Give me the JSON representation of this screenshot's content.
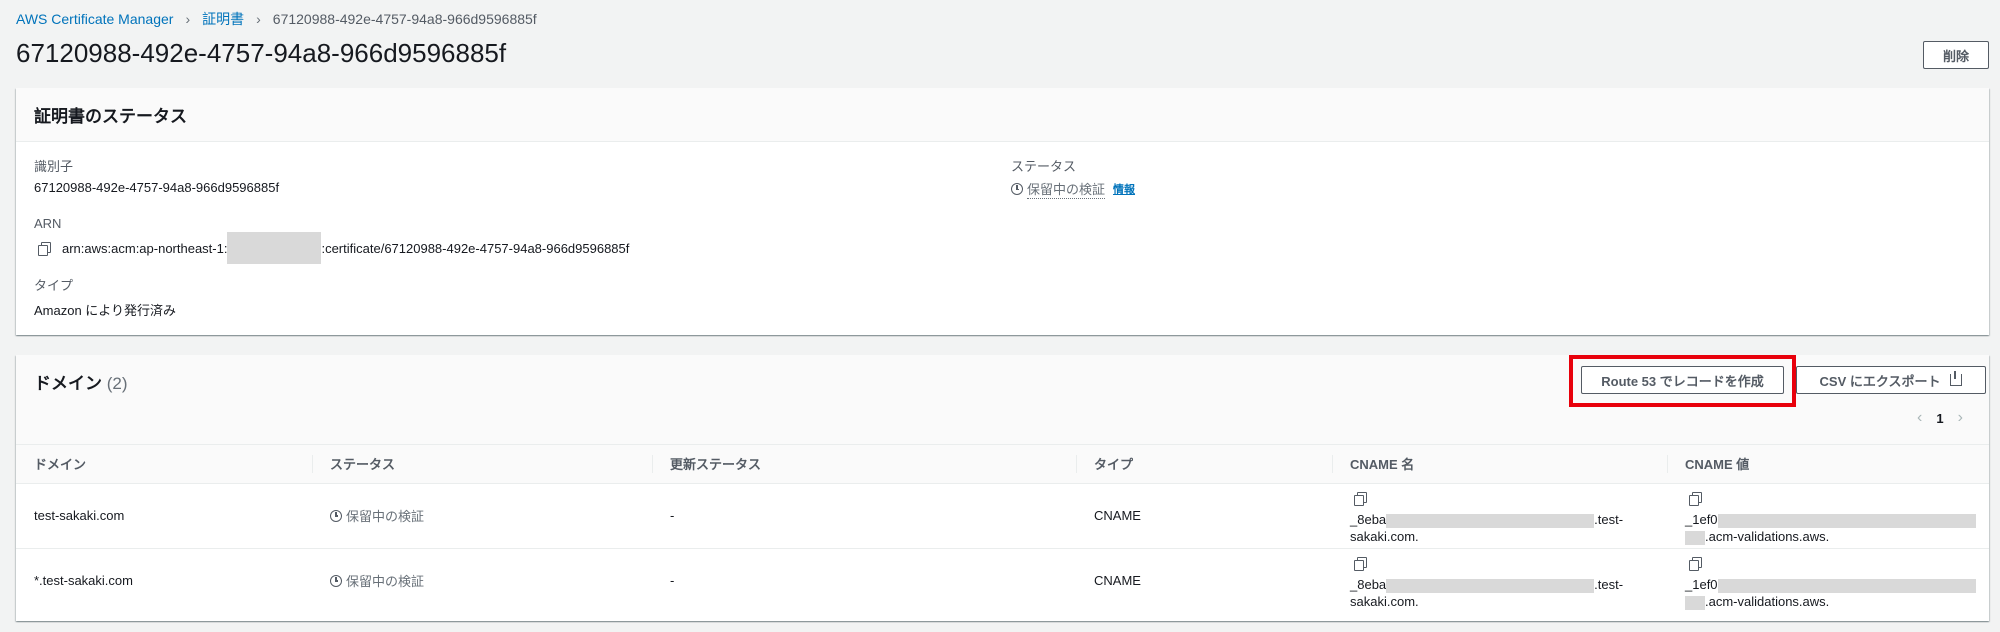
{
  "breadcrumb": {
    "items": [
      "AWS Certificate Manager",
      "証明書"
    ],
    "current": "67120988-492e-4757-94a8-966d9596885f"
  },
  "page_title": "67120988-492e-4757-94a8-966d9596885f",
  "delete_button": "削除",
  "status_panel": {
    "title": "証明書のステータス",
    "identifier_label": "識別子",
    "identifier_value": "67120988-492e-4757-94a8-966d9596885f",
    "status_label": "ステータス",
    "status_value": "保留中の検証",
    "info_link": "情報",
    "arn_label": "ARN",
    "arn_prefix": "arn:aws:acm:ap-northeast-1:",
    "arn_suffix": ":certificate/67120988-492e-4757-94a8-966d9596885f",
    "type_label": "タイプ",
    "type_value": "Amazon により発行済み"
  },
  "domain_panel": {
    "title": "ドメイン",
    "count": "(2)",
    "route53_button": "Route 53 でレコードを作成",
    "csv_button": "CSV にエクスポート",
    "page_number": "1",
    "columns": [
      "ドメイン",
      "ステータス",
      "更新ステータス",
      "タイプ",
      "CNAME 名",
      "CNAME 値"
    ],
    "rows": [
      {
        "domain": "test-sakaki.com",
        "status": "保留中の検証",
        "renewal_status": "-",
        "type": "CNAME",
        "cname_name_prefix": "_8eba",
        "cname_name_suffix": ".test-",
        "cname_name_line2": "sakaki.com.",
        "cname_value_prefix": "_1ef0",
        "cname_value_line2": ".acm-validations.aws."
      },
      {
        "domain": "*.test-sakaki.com",
        "status": "保留中の検証",
        "renewal_status": "-",
        "type": "CNAME",
        "cname_name_prefix": "_8eba",
        "cname_name_suffix": ".test-",
        "cname_name_line2": "sakaki.com.",
        "cname_value_prefix": "_1ef0",
        "cname_value_line2": ".acm-validations.aws."
      }
    ]
  },
  "colors": {
    "link": "#0073bb",
    "highlight": "#e8000b",
    "background": "#f2f3f3"
  }
}
